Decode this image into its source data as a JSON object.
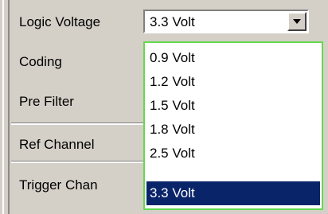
{
  "rows": [
    {
      "label": "Logic Voltage"
    },
    {
      "label": "Coding"
    },
    {
      "label": "Pre Filter"
    },
    {
      "label": "Ref Channel"
    },
    {
      "label": "Trigger Chan"
    }
  ],
  "logic_voltage": {
    "selected": "3.3 Volt",
    "options": [
      "0.9 Volt",
      "1.2 Volt",
      "1.5 Volt",
      "1.8 Volt",
      "2.5 Volt",
      "3.3 Volt"
    ],
    "selected_index": 5
  },
  "icons": {
    "dropdown_arrow": "chevron-down-icon"
  }
}
